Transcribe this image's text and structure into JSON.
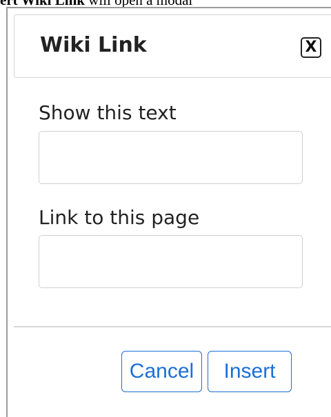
{
  "caption": {
    "bold_text": "ert Wiki Link",
    "rest_text": " will open a modal"
  },
  "modal": {
    "title": "Wiki Link",
    "close_label": "X",
    "fields": [
      {
        "label": "Show this text",
        "value": "",
        "placeholder": ""
      },
      {
        "label": "Link to this page",
        "value": "",
        "placeholder": ""
      }
    ],
    "buttons": {
      "cancel_label": "Cancel",
      "insert_label": "Insert"
    }
  },
  "colors": {
    "accent": "#1a6fd6",
    "border": "#cfcfcf",
    "text": "#222222"
  }
}
